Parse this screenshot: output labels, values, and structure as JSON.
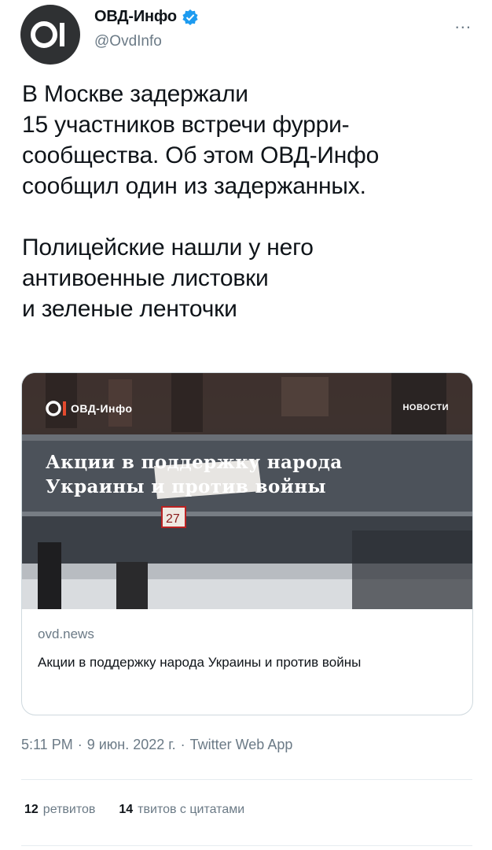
{
  "account": {
    "name": "ОВД-Инфо",
    "handle": "@OvdInfo",
    "more_label": "..."
  },
  "tweet": {
    "paragraph1": [
      "В Москве задержали",
      "15 участников встречи фурри-",
      "сообщества. Об этом ОВД-Инфо",
      "сообщил один из задержанных."
    ],
    "paragraph2": [
      "Полицейские нашли у него",
      "антивоенные листовки",
      "и зеленые ленточки"
    ]
  },
  "card": {
    "image_brand": "ОВД-Инфо",
    "image_tag": "НОВОСТИ",
    "image_headline": [
      "Акции в поддержку народа",
      "Украины и против войны"
    ],
    "sign_number": "27",
    "domain": "ovd.news",
    "title": "Акции в поддержку народа Украины и против войны"
  },
  "meta": {
    "time": "5:11 PM",
    "date": "9 июн. 2022 г.",
    "source": "Twitter Web App",
    "separator": "·"
  },
  "stats": {
    "retweets_count": "12",
    "retweets_label": "ретвитов",
    "quotes_count": "14",
    "quotes_label": "твитов с цитатами"
  },
  "colors": {
    "verified": "#1d9bf0",
    "secondary_text": "#6b7a86",
    "avatar_bg": "#2f3133"
  }
}
